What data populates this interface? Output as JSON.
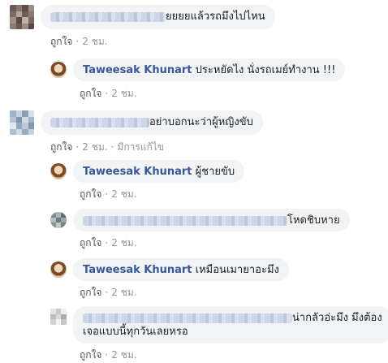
{
  "comments": [
    {
      "text": "ยยยยแล้วรถมึงไปไหน",
      "actions": {
        "like": "ถูกใจ",
        "time": "2 ชม."
      }
    },
    {
      "author": "Taweesak Khunart",
      "text": "ประหยัดไง นั่งรถเมย์ทำงาน !!!",
      "actions": {
        "like": "ถูกใจ",
        "time": "2 ชม."
      }
    },
    {
      "text": "อย่าบอกนะว่าผู้หญิงขับ",
      "actions": {
        "like": "ถูกใจ",
        "time": "2 ชม.",
        "edited": "มีการแก้ไข"
      }
    },
    {
      "author": "Taweesak Khunart",
      "text": "ผู้ชายขับ",
      "actions": {
        "like": "ถูกใจ",
        "time": "2 ชม."
      }
    },
    {
      "text": "โหดชิบหาย",
      "actions": {
        "like": "ถูกใจ",
        "time": "2 ชม."
      }
    },
    {
      "author": "Taweesak Khunart",
      "text": "เหมือนเมายาอะมึง",
      "actions": {
        "like": "ถูกใจ",
        "time": "2 ชม."
      }
    },
    {
      "text_line1": "น่ากลัวอ่ะมึง มึงต้อง",
      "text_line2": "เจอแบบนี้ทุกวันเลยหรอ",
      "actions": {
        "like": "ถูกใจ",
        "time": "2 ชม."
      }
    }
  ],
  "colors": {
    "author": "#385898",
    "bubble": "#f2f3f5",
    "meta": "#90949c"
  }
}
